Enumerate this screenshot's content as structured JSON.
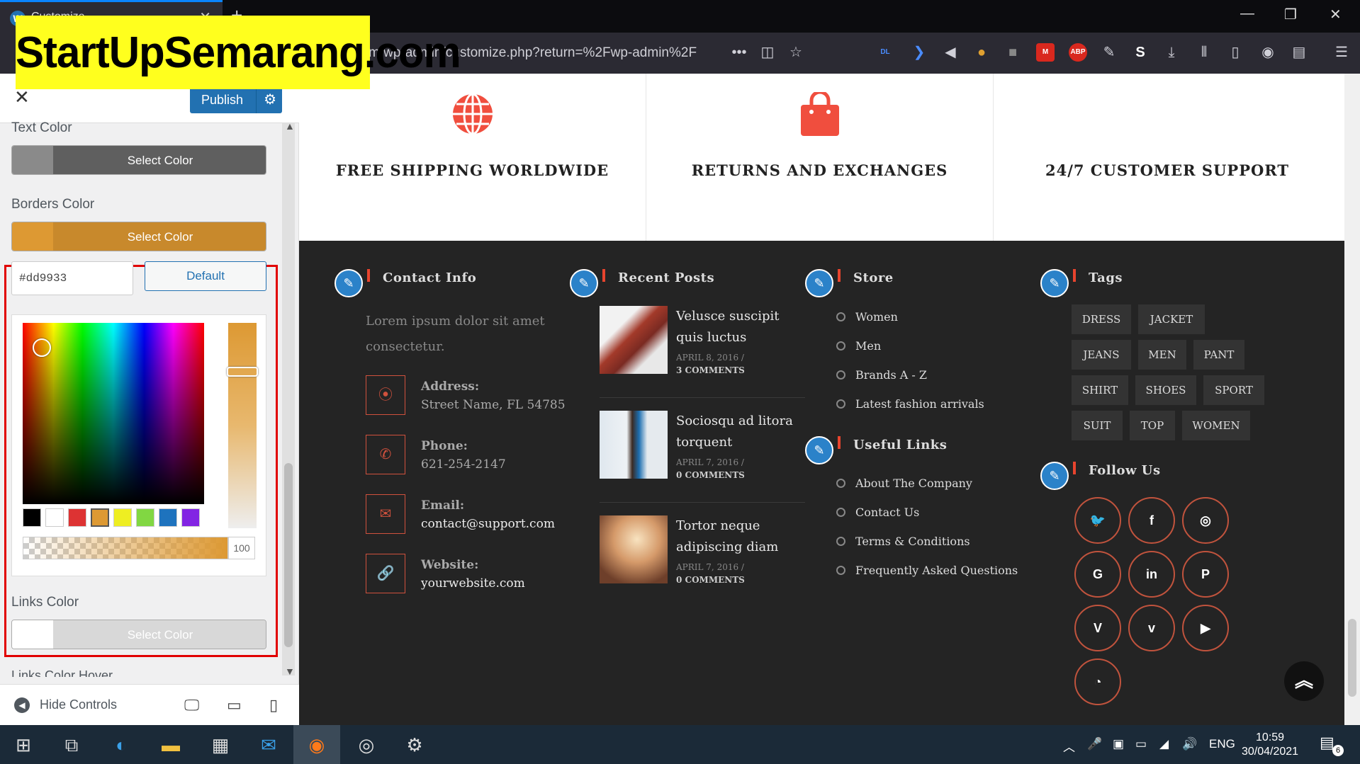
{
  "browser": {
    "tab_title": "Customize",
    "tab_close": "✕",
    "new_tab": "+",
    "url": "m/wp-admin/customize.php?return=%2Fwp-admin%2F",
    "window_controls": [
      "—",
      "❐",
      "✕"
    ],
    "extension_icons": [
      "dl-icon",
      "arrow-icon",
      "speaker-icon",
      "monkey-icon",
      "extension-icon",
      "mega-icon",
      "abp-icon",
      "pen-icon",
      "s-icon",
      "download-icon",
      "library-icon",
      "sidebar-icon",
      "account-icon",
      "reader-icon",
      "menu-icon"
    ]
  },
  "watermark": "StartUpSemarang.com",
  "customizer": {
    "close": "✕",
    "publish": "Publish",
    "publish_gear": "⚙",
    "text_color_label": "Text Color",
    "text_color_button": "Select Color",
    "borders_color_label": "Borders Color",
    "borders_color_button": "Select Color",
    "hex_value": "#dd9933",
    "default_button": "Default",
    "palette": [
      "#000000",
      "#ffffff",
      "#dd3333",
      "#dd9933",
      "#eeee22",
      "#81d742",
      "#1e73be",
      "#8224e3"
    ],
    "alpha_value": "100",
    "links_color_label": "Links Color",
    "links_color_button": "Select Color",
    "links_color_hover_label": "Links Color Hover",
    "hide_controls": "Hide Controls",
    "colors": {
      "text_swatch": "#808080",
      "border_swatch": "#dd9933",
      "links_swatch": "#ffffff",
      "accent": "#2271b1"
    }
  },
  "site": {
    "features": [
      {
        "icon": "globe-icon",
        "title": "FREE SHIPPING WORLDWIDE"
      },
      {
        "icon": "shopping-bag-icon",
        "title": "RETURNS AND EXCHANGES"
      },
      {
        "icon": "support-icon",
        "title": "24/7 CUSTOMER SUPPORT"
      }
    ],
    "contact": {
      "heading": "Contact Info",
      "intro": "Lorem ipsum dolor sit amet consectetur.",
      "items": [
        {
          "label": "Address:",
          "value": "Street Name, FL 54785"
        },
        {
          "label": "Phone:",
          "value": "621-254-2147"
        },
        {
          "label": "Email:",
          "value": "contact@support.com"
        },
        {
          "label": "Website:",
          "value": "yourwebsite.com"
        }
      ]
    },
    "recent_posts": {
      "heading": "Recent Posts",
      "posts": [
        {
          "title": "Veluscе suscipit quis luctus",
          "date": "APRIL 8, 2016 /",
          "comments": "3 COMMENTS"
        },
        {
          "title": "Sociosqu ad litora torquent",
          "date": "APRIL 7, 2016 /",
          "comments": "0 COMMENTS"
        },
        {
          "title": "Tortor neque adipiscing diam",
          "date": "APRIL 7, 2016 /",
          "comments": "0 COMMENTS"
        }
      ]
    },
    "store": {
      "heading": "Store",
      "items": [
        "Women",
        "Men",
        "Brands A - Z",
        "Latest fashion arrivals"
      ]
    },
    "useful_links": {
      "heading": "Useful Links",
      "items": [
        "About The Company",
        "Contact Us",
        "Terms & Conditions",
        "Frequently Asked Questions"
      ]
    },
    "tags": {
      "heading": "Tags",
      "items": [
        "DRESS",
        "JACKET",
        "JEANS",
        "MEN",
        "PANT",
        "SHIRT",
        "SHOES",
        "SPORT",
        "SUIT",
        "TOP",
        "WOMEN"
      ]
    },
    "follow": {
      "heading": "Follow Us",
      "networks": [
        "twitter-icon",
        "facebook-icon",
        "instagram-icon",
        "google-icon",
        "linkedin-icon",
        "pinterest-icon",
        "vimeo-icon",
        "vine-icon",
        "youtube-icon",
        "rss-icon"
      ]
    }
  },
  "taskbar": {
    "language": "ENG",
    "time": "10:59",
    "date": "30/04/2021",
    "notifications": "6"
  }
}
